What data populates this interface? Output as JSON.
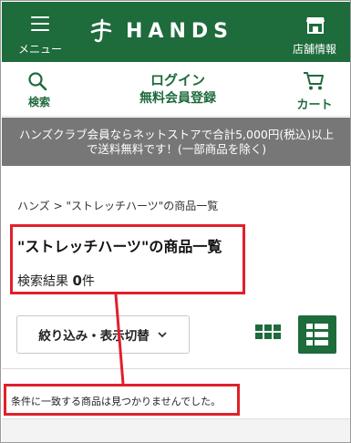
{
  "header": {
    "menu_label": "メニュー",
    "logo_text": "HANDS",
    "store_label": "店舗情報"
  },
  "subheader": {
    "search_label": "検索",
    "login_label": "ログイン",
    "register_label": "無料会員登録",
    "cart_label": "カート"
  },
  "notice": {
    "line1": "ハンズクラブ会員ならネットストアで合計5,000円(税込)以上",
    "line2": "で送料無料です！(一部商品を除く)"
  },
  "breadcrumb": {
    "home": "ハンズ",
    "separator": ">",
    "current": "\"ストレッチハーツ\"の商品一覧"
  },
  "main": {
    "title": "\"ストレッチハーツ\"の商品一覧",
    "result_label": "検索結果",
    "result_count": "0",
    "result_unit": "件",
    "filter_button": "絞り込み・表示切替",
    "empty_message": "条件に一致する商品は見つかりませんでした。"
  },
  "colors": {
    "brand_green": "#1e6b3c",
    "notice_gray": "#777777",
    "annotation_red": "#e0202a"
  },
  "icons": {
    "menu": "hamburger-icon",
    "logo": "hands-logo-mark",
    "store": "store-icon",
    "search": "search-icon",
    "cart": "cart-icon",
    "filter_chevron": "chevron-down-icon",
    "grid_view": "grid-view-icon",
    "list_view": "list-view-icon"
  }
}
